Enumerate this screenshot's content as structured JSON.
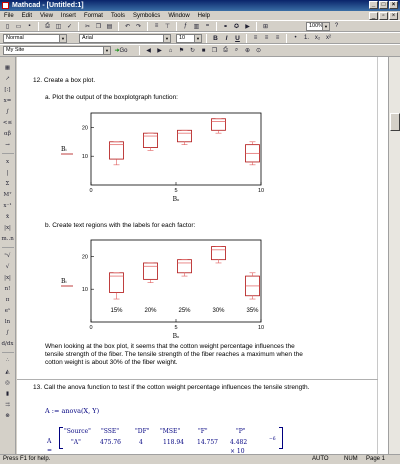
{
  "app": {
    "title": "Mathcad - [Untitled:1]"
  },
  "menu": [
    "File",
    "Edit",
    "View",
    "Insert",
    "Format",
    "Tools",
    "Symbolics",
    "Window",
    "Help"
  ],
  "format_bar": {
    "style": "Normal",
    "font": "Arial",
    "size": "10",
    "zoom": "100%"
  },
  "resource": {
    "label": "My Site",
    "go": "Go"
  },
  "sections": {
    "s12": "12. Create a box plot.",
    "s12a": "a. Plot the output of the boxplotgraph function:",
    "s12b": "b. Create text regions with the labels for each factor:",
    "analysis": "When looking at the box plot, it seems that the cotton weight percentage influences the tensile strength of the fiber. The tensile strength of the fiber reaches a maximum when the cotton weight is about 30% of the fiber weight.",
    "s13": "13. Call the anova function to test if the cotton weight percentage influences the tensile strength.",
    "anova_def": "A := anova(X, Y)"
  },
  "anova": {
    "prefix": "A =",
    "headers": [
      "\"Source\"",
      "\"SSE\"",
      "\"DF\"",
      "\"MSE\"",
      "\"F\"",
      "\"P\""
    ],
    "row": [
      "\"A\"",
      "475.76",
      "4",
      "118.94",
      "14.757",
      "4.482 × 10"
    ],
    "exp": "−6"
  },
  "chart_data": [
    {
      "type": "box",
      "x_ticks": [
        "0",
        "5",
        "10"
      ],
      "y_ticks": [
        "10",
        "20"
      ],
      "xlim": [
        0,
        10
      ],
      "ylim": [
        0,
        25
      ],
      "y_label": "Bᵢ",
      "x_label": "Bₒ",
      "boxes": [
        {
          "x": 1.5,
          "low": 7,
          "q1": 9,
          "median": 14,
          "q3": 15,
          "high": 15
        },
        {
          "x": 3.5,
          "low": 12,
          "q1": 13,
          "median": 17,
          "q3": 18,
          "high": 18
        },
        {
          "x": 5.5,
          "low": 14,
          "q1": 15,
          "median": 18,
          "q3": 19,
          "high": 19
        },
        {
          "x": 7.5,
          "low": 18,
          "q1": 19,
          "median": 22,
          "q3": 23,
          "high": 23
        },
        {
          "x": 9.5,
          "low": 7,
          "q1": 8,
          "median": 11,
          "q3": 14,
          "high": 15
        }
      ]
    },
    {
      "type": "box",
      "x_ticks": [
        "0",
        "5",
        "10"
      ],
      "y_ticks": [
        "10",
        "20"
      ],
      "xlim": [
        0,
        10
      ],
      "ylim": [
        0,
        25
      ],
      "y_label": "Bᵢ",
      "x_label": "Bₒ",
      "annotations": [
        "15%",
        "20%",
        "25%",
        "30%",
        "35%"
      ],
      "boxes": [
        {
          "x": 1.5,
          "low": 7,
          "q1": 9,
          "median": 14,
          "q3": 15,
          "high": 15
        },
        {
          "x": 3.5,
          "low": 12,
          "q1": 13,
          "median": 17,
          "q3": 18,
          "high": 18
        },
        {
          "x": 5.5,
          "low": 14,
          "q1": 15,
          "median": 18,
          "q3": 19,
          "high": 19
        },
        {
          "x": 7.5,
          "low": 18,
          "q1": 19,
          "median": 22,
          "q3": 23,
          "high": 23
        },
        {
          "x": 9.5,
          "low": 7,
          "q1": 8,
          "median": 11,
          "q3": 14,
          "high": 15
        }
      ]
    }
  ],
  "status": {
    "help": "Press F1 for help.",
    "auto": "AUTO",
    "num": "NUM",
    "page": "Page 1"
  },
  "colors": {
    "box": "#b01010",
    "box_light": "#e05a5a",
    "frame": "#000000"
  }
}
